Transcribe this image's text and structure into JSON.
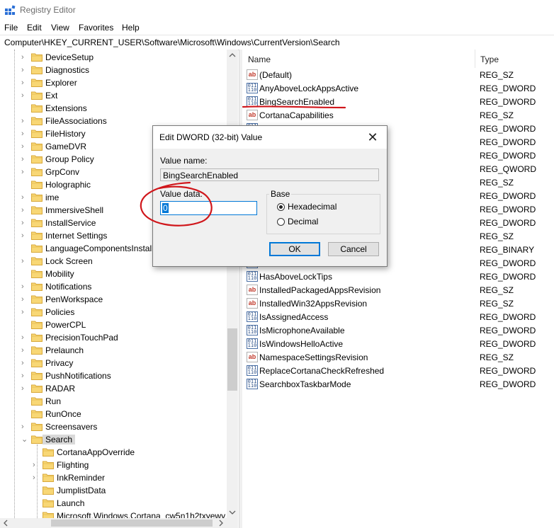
{
  "window": {
    "title": "Registry Editor"
  },
  "menu": [
    "File",
    "Edit",
    "View",
    "Favorites",
    "Help"
  ],
  "address": "Computer\\HKEY_CURRENT_USER\\Software\\Microsoft\\Windows\\CurrentVersion\\Search",
  "tree": {
    "items": [
      {
        "label": "DeviceSetup",
        "expandable": true
      },
      {
        "label": "Diagnostics",
        "expandable": true
      },
      {
        "label": "Explorer",
        "expandable": true
      },
      {
        "label": "Ext",
        "expandable": true
      },
      {
        "label": "Extensions",
        "expandable": false
      },
      {
        "label": "FileAssociations",
        "expandable": true
      },
      {
        "label": "FileHistory",
        "expandable": true
      },
      {
        "label": "GameDVR",
        "expandable": true
      },
      {
        "label": "Group Policy",
        "expandable": true
      },
      {
        "label": "GrpConv",
        "expandable": true
      },
      {
        "label": "Holographic",
        "expandable": false
      },
      {
        "label": "ime",
        "expandable": true
      },
      {
        "label": "ImmersiveShell",
        "expandable": true
      },
      {
        "label": "InstallService",
        "expandable": true
      },
      {
        "label": "Internet Settings",
        "expandable": true
      },
      {
        "label": "LanguageComponentsInstall",
        "expandable": false
      },
      {
        "label": "Lock Screen",
        "expandable": true
      },
      {
        "label": "Mobility",
        "expandable": false
      },
      {
        "label": "Notifications",
        "expandable": true
      },
      {
        "label": "PenWorkspace",
        "expandable": true
      },
      {
        "label": "Policies",
        "expandable": true
      },
      {
        "label": "PowerCPL",
        "expandable": false
      },
      {
        "label": "PrecisionTouchPad",
        "expandable": true
      },
      {
        "label": "Prelaunch",
        "expandable": true
      },
      {
        "label": "Privacy",
        "expandable": true
      },
      {
        "label": "PushNotifications",
        "expandable": true
      },
      {
        "label": "RADAR",
        "expandable": true
      },
      {
        "label": "Run",
        "expandable": false
      },
      {
        "label": "RunOnce",
        "expandable": false
      },
      {
        "label": "Screensavers",
        "expandable": true
      },
      {
        "label": "Search",
        "expandable": true,
        "expanded": true,
        "selected": true
      }
    ],
    "children": [
      {
        "label": "CortanaAppOverride",
        "expandable": false
      },
      {
        "label": "Flighting",
        "expandable": true
      },
      {
        "label": "InkReminder",
        "expandable": true
      },
      {
        "label": "JumplistData",
        "expandable": false
      },
      {
        "label": "Launch",
        "expandable": false
      },
      {
        "label": "Microsoft.Windows.Cortana_cw5n1h2txyewy",
        "expandable": false
      }
    ]
  },
  "values": {
    "columns": {
      "name": "Name",
      "type": "Type"
    },
    "rows": [
      {
        "name": "(Default)",
        "type": "REG_SZ",
        "icon": "ab"
      },
      {
        "name": "AnyAboveLockAppsActive",
        "type": "REG_DWORD",
        "icon": "bin"
      },
      {
        "name": "BingSearchEnabled",
        "type": "REG_DWORD",
        "icon": "bin"
      },
      {
        "name": "CortanaCapabilities",
        "type": "REG_SZ",
        "icon": "ab"
      },
      {
        "name": "",
        "type": "REG_DWORD",
        "icon": "bin"
      },
      {
        "name": "",
        "type": "REG_DWORD",
        "icon": "bin"
      },
      {
        "name": "",
        "type": "REG_DWORD",
        "icon": "bin"
      },
      {
        "name": "",
        "type": "REG_QWORD",
        "icon": "bin"
      },
      {
        "name": "",
        "type": "REG_SZ",
        "icon": "ab"
      },
      {
        "name": "",
        "type": "REG_DWORD",
        "icon": "bin"
      },
      {
        "name": "",
        "type": "REG_DWORD",
        "icon": "bin"
      },
      {
        "name": "",
        "type": "REG_DWORD",
        "icon": "bin"
      },
      {
        "name": "",
        "type": "REG_SZ",
        "icon": "ab"
      },
      {
        "name": "",
        "type": "REG_BINARY",
        "icon": "bin"
      },
      {
        "name": "",
        "type": "REG_DWORD",
        "icon": "bin"
      },
      {
        "name": "HasAboveLockTips",
        "type": "REG_DWORD",
        "icon": "bin"
      },
      {
        "name": "InstalledPackagedAppsRevision",
        "type": "REG_SZ",
        "icon": "ab"
      },
      {
        "name": "InstalledWin32AppsRevision",
        "type": "REG_SZ",
        "icon": "ab"
      },
      {
        "name": "IsAssignedAccess",
        "type": "REG_DWORD",
        "icon": "bin"
      },
      {
        "name": "IsMicrophoneAvailable",
        "type": "REG_DWORD",
        "icon": "bin"
      },
      {
        "name": "IsWindowsHelloActive",
        "type": "REG_DWORD",
        "icon": "bin"
      },
      {
        "name": "NamespaceSettingsRevision",
        "type": "REG_SZ",
        "icon": "ab"
      },
      {
        "name": "ReplaceCortanaCheckRefreshed",
        "type": "REG_DWORD",
        "icon": "bin"
      },
      {
        "name": "SearchboxTaskbarMode",
        "type": "REG_DWORD",
        "icon": "bin"
      }
    ]
  },
  "dialog": {
    "title": "Edit DWORD (32-bit) Value",
    "value_name_label": "Value name:",
    "value_name": "BingSearchEnabled",
    "value_data_label": "Value data:",
    "value_data": "0",
    "base_label": "Base",
    "hex_label": "Hexadecimal",
    "dec_label": "Decimal",
    "base_selected": "Hexadecimal",
    "ok_label": "OK",
    "cancel_label": "Cancel",
    "close_glyph": "✕"
  },
  "annotation_color": "#d0161b"
}
